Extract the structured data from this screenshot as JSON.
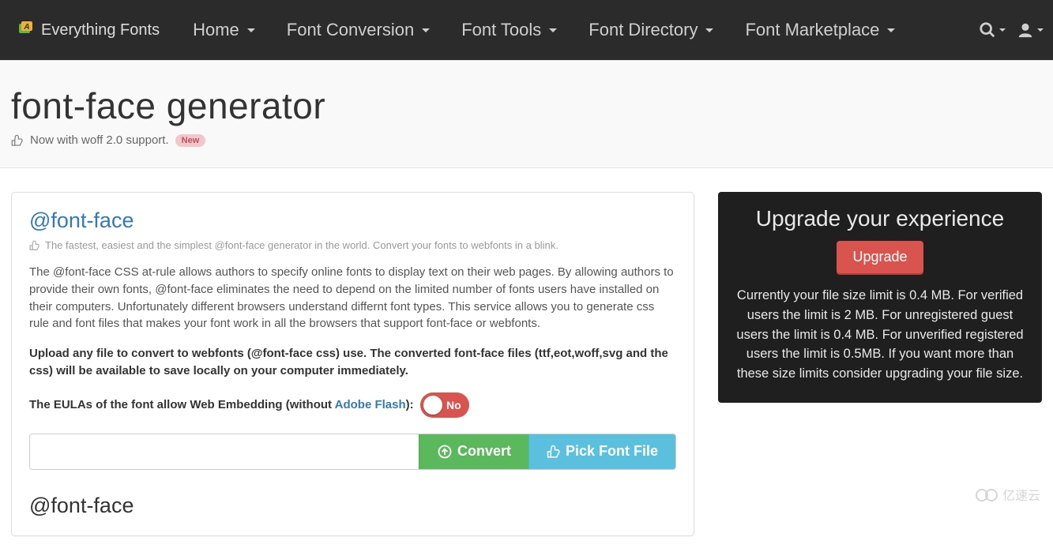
{
  "brand": "Everything Fonts",
  "nav": {
    "home": "Home",
    "conversion": "Font Conversion",
    "tools": "Font Tools",
    "directory": "Font Directory",
    "marketplace": "Font Marketplace"
  },
  "hero": {
    "title": "font-face generator",
    "sub": "Now with woff 2.0 support.",
    "badge": "New"
  },
  "panel": {
    "heading": "@font-face",
    "tagline": "The fastest, easiest and the simplest @font-face generator in the world. Convert your fonts to webfonts in a blink.",
    "desc": "The @font-face CSS at-rule allows authors to specify online fonts to display text on their web pages. By allowing authors to provide their own fonts, @font-face eliminates the need to depend on the limited number of fonts users have installed on their computers. Unfortunately different browsers understand differnt font types. This service allows you to generate css rule and font files that makes your font work in all the browsers that support font-face or webfonts.",
    "desc2": "Upload any file to convert to webfonts (@font-face css) use. The converted font-face files (ttf,eot,woff,svg and the css) will be available to save locally on your computer immediately.",
    "eula_pre": "The EULAs of the font allow Web Embedding (without ",
    "adobe_flash": "Adobe Flash",
    "eula_post": "): ",
    "toggle_label": "No",
    "convert_label": "Convert",
    "pick_label": "Pick Font File",
    "sub_heading": "@font-face"
  },
  "upgrade": {
    "heading": "Upgrade your experience",
    "button": "Upgrade",
    "body": "Currently your file size limit is 0.4 MB. For verified users the limit is 2 MB. For unregistered guest users the limit is 0.4 MB. For unverified registered users the limit is 0.5MB. If you want more than these size limits consider upgrading your file size."
  },
  "watermark": "亿速云"
}
